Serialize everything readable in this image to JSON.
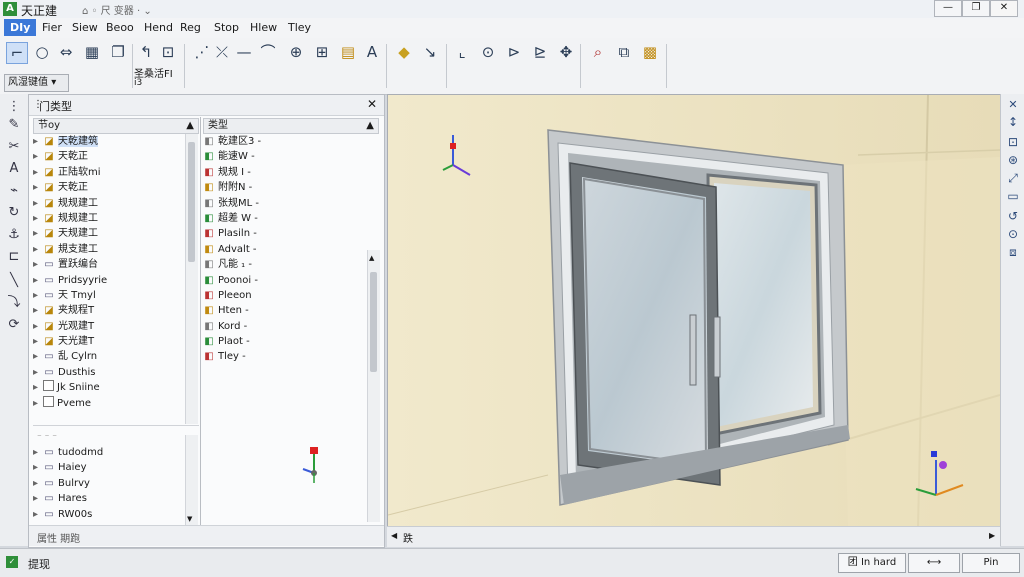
{
  "window": {
    "title": "天正建",
    "quick_access": "⌂ ◦ 尺 变器 · ⌄",
    "controls": [
      "—",
      "❐",
      "✕"
    ]
  },
  "menu": [
    {
      "label": "DIy",
      "active": true
    },
    {
      "label": "Fier"
    },
    {
      "label": "Siew"
    },
    {
      "label": "Beoo"
    },
    {
      "label": "Hend"
    },
    {
      "label": "Reg"
    },
    {
      "label": "Stop"
    },
    {
      "label": "Hlew"
    },
    {
      "label": "Tley"
    }
  ],
  "toolbar": {
    "workspace": "风湿键值",
    "group_label": "圣桑活FI",
    "group_sub": "i3",
    "icons": [
      "select-icon",
      "zoom-icon",
      "move-icon",
      "grid-icon",
      "box-icon",
      "wall-icon",
      "trim-icon",
      "line-icon",
      "arc-icon",
      "circle-icon",
      "array-icon",
      "table-icon",
      "text-icon",
      "layer-icon",
      "cut-icon",
      "ucs-icon",
      "orbit-icon",
      "snap-icon",
      "snap2-icon",
      "pan-icon",
      "search-icon",
      "view-icon",
      "render-icon"
    ]
  },
  "panel": {
    "title": "门类型",
    "col1_header": "节oy",
    "col2_header": "类型",
    "tree_items": [
      {
        "label": "天乾建筑",
        "selected": true,
        "kind": "folder"
      },
      {
        "label": "天乾正",
        "kind": "folder"
      },
      {
        "label": "正陆软mi",
        "kind": "folder"
      },
      {
        "label": "天乾正",
        "kind": "folder"
      },
      {
        "label": "规规建工",
        "kind": "folder"
      },
      {
        "label": "规规建工",
        "kind": "folder"
      },
      {
        "label": "天规建工",
        "kind": "folder"
      },
      {
        "label": "規支建工",
        "kind": "folder"
      },
      {
        "label": "置跃编台",
        "kind": "item"
      },
      {
        "label": "Pridsyyrie",
        "kind": "item"
      },
      {
        "label": "天 Tmyl",
        "kind": "item"
      },
      {
        "label": "夹规程T",
        "kind": "folder"
      },
      {
        "label": "光观建T",
        "kind": "folder"
      },
      {
        "label": "天光建T",
        "kind": "folder"
      },
      {
        "label": "乱 Cylrn",
        "kind": "item"
      },
      {
        "label": "Dusthis",
        "kind": "item"
      },
      {
        "label": "Jk Sniine",
        "kind": "check"
      },
      {
        "label": "Pveme",
        "kind": "check"
      }
    ],
    "tree_items_b": [
      {
        "label": "tudodmd",
        "kind": "item"
      },
      {
        "label": "Haiey",
        "kind": "item"
      },
      {
        "label": "Bulrvy",
        "kind": "item"
      },
      {
        "label": "Hares",
        "kind": "item"
      },
      {
        "label": "RW00s",
        "kind": "item"
      }
    ],
    "type_items": [
      "乾建区3 -",
      "能速W -",
      "规规 I -",
      "附附N -",
      "张规ML -",
      "超差 W -",
      "Plasiln -",
      "Advalt -",
      "凡能 ₁ -",
      "Poonoi -",
      "Pleeon",
      "Hten -",
      "Kord -",
      "Plaot -",
      "Tley -"
    ],
    "footer": "属性 期跑"
  },
  "viewport": {
    "scroll_label": "跌"
  },
  "statusbar": {
    "text": "提现",
    "buttons": [
      "团 In hard",
      "⟷",
      "Pin"
    ]
  }
}
